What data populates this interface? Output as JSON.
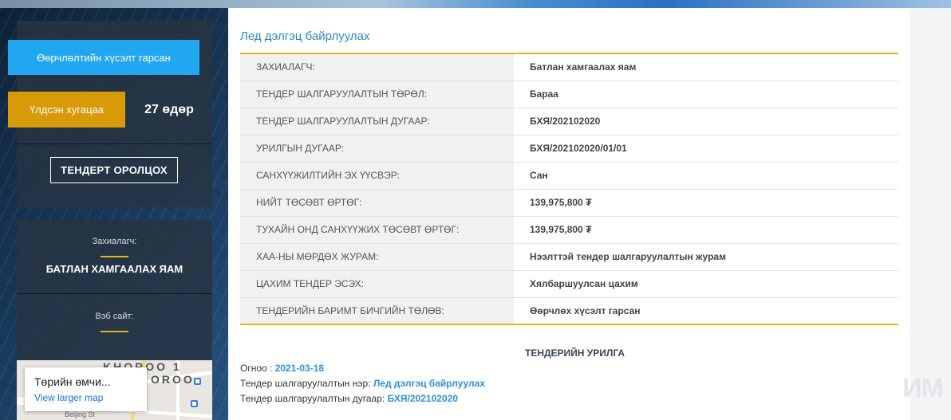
{
  "sidebar": {
    "status_banner": "Өөрчлөлтийн хүсэлт гарсан",
    "remaining_label": "Үлдсэн хугацаа",
    "remaining_value": "27 өдөр",
    "participate_button": "ТЕНДЕРТ ОРОЛЦОХ",
    "orderer_label": "Захиалагч:",
    "orderer_name": "БАТЛАН ХАМГААЛАХ ЯАМ",
    "website_label": "Вэб сайт:",
    "map": {
      "card_title": "Төрийн өмчи...",
      "card_link": "View larger map",
      "street_label_1": "KHOROO 1",
      "street_label_2": "OROO",
      "street_label_3": "Beijing St"
    }
  },
  "main": {
    "title": "Лед дэлгэц байрлуулах",
    "details": [
      {
        "label": "ЗАХИАЛАГЧ:",
        "value": "Батлан хамгаалах яам"
      },
      {
        "label": "ТЕНДЕР ШАЛГАРУУЛАЛТЫН ТӨРӨЛ:",
        "value": "Бараа"
      },
      {
        "label": "ТЕНДЕР ШАЛГАРУУЛАЛТЫН ДУГААР:",
        "value": "БХЯ/202102020"
      },
      {
        "label": "УРИЛГЫН ДУГААР:",
        "value": "БХЯ/202102020/01/01"
      },
      {
        "label": "САНХҮҮЖИЛТИЙН ЭХ ҮҮСВЭР:",
        "value": "Сан"
      },
      {
        "label": "НИЙТ ТӨСӨВТ ӨРТӨГ:",
        "value": "139,975,800 ₮"
      },
      {
        "label": "ТУХАЙН ОНД САНХҮҮЖИХ ТӨСӨВТ ӨРТӨГ:",
        "value": "139,975,800 ₮"
      },
      {
        "label": "ХАА-НЫ МӨРДӨХ ЖУРАМ:",
        "value": "Нээлттэй тендер шалгаруулалтын журам"
      },
      {
        "label": "ЦАХИМ ТЕНДЕР ЭСЭХ:",
        "value": "Хялбаршуулсан цахим"
      },
      {
        "label": "ТЕНДЕРИЙН БАРИМТ БИЧГИЙН ТӨЛӨВ:",
        "value": "Өөрчлөх хүсэлт гарсан"
      }
    ],
    "invitation_heading": "ТЕНДЕРИЙН УРИЛГА",
    "date_label": "Огноо : ",
    "date_value": "2021-03-18",
    "tender_name_label": "Тендер шалгаруулалтын нэр: ",
    "tender_name_value": "Лед дэлгэц байрлуулах",
    "tender_no_label": "Тендер шалгаруулалтын дугаар: ",
    "tender_no_value": "БХЯ/202102020"
  },
  "watermark": "ИМ"
}
